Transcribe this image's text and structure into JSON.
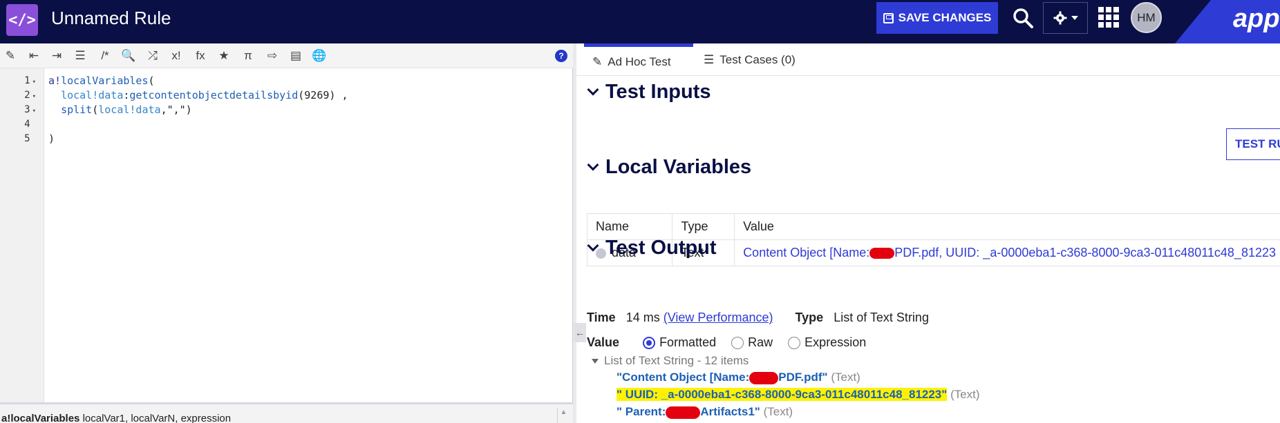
{
  "header": {
    "logo_glyph": "</>",
    "title": "Unnamed Rule",
    "save_label": "SAVE CHANGES",
    "avatar_initials": "HM",
    "brand": "appia",
    "icons": [
      "code-icon",
      "save-icon",
      "search-icon",
      "gear-icon",
      "chevron-down-icon",
      "app-grid-icon"
    ]
  },
  "editor": {
    "toolbar_icons": [
      "magic-wand-icon",
      "outdent-icon",
      "indent-icon",
      "list-icon",
      "comment-icon",
      "search-icon",
      "shuffle-icon",
      "factorial-icon",
      "function-icon",
      "star-icon",
      "pi-icon",
      "export-icon",
      "database-search-icon",
      "globe-icon"
    ],
    "toolbar_glyphs": [
      "✎",
      "⇤",
      "⇥",
      "☰",
      "/*",
      "🔍",
      "⤮",
      "x!",
      "fx",
      "★",
      "π",
      "⇨",
      "▤",
      "🌐"
    ],
    "help_glyph": "?",
    "line_numbers": [
      "1",
      "2",
      "3",
      "4",
      "5"
    ],
    "code_lines": [
      {
        "parts": [
          [
            "a!",
            "k-purple"
          ],
          [
            "localVariables",
            "k-blue"
          ],
          [
            "(",
            "k-dark"
          ]
        ]
      },
      {
        "parts": [
          [
            "  ",
            "k-dark"
          ],
          [
            "local!data",
            "k-lv"
          ],
          [
            ":",
            "k-dark"
          ],
          [
            "getcontentobjectdetailsbyid",
            "k-blue"
          ],
          [
            "(",
            "k-dark"
          ],
          [
            "9269",
            "k-num"
          ],
          [
            ") ,",
            "k-dark"
          ]
        ]
      },
      {
        "parts": [
          [
            "  ",
            "k-dark"
          ],
          [
            "split",
            "k-blue"
          ],
          [
            "(",
            "k-dark"
          ],
          [
            "local!data",
            "k-lv"
          ],
          [
            ",\",\")",
            "k-dark"
          ]
        ]
      },
      {
        "parts": []
      },
      {
        "parts": [
          [
            ")",
            "k-dark"
          ]
        ]
      }
    ],
    "hint": {
      "bold": "a!localVariables",
      "rest": " localVar1, localVarN, expression"
    }
  },
  "tabs": [
    {
      "label": "Ad Hoc Test",
      "icon": "edit-icon",
      "glyph": "✎",
      "active": true
    },
    {
      "label": "Test Cases (0)",
      "icon": "list-icon",
      "glyph": "☰",
      "active": false
    }
  ],
  "test_inputs": {
    "heading": "Test Inputs",
    "test_button": "TEST RULE"
  },
  "local_variables": {
    "heading": "Local Variables",
    "columns": [
      "Name",
      "Type",
      "Value"
    ],
    "rows": [
      {
        "name": "data",
        "type": "Text",
        "value_prefix": "Content Object [Name:",
        "value_suffix": "PDF.pdf, UUID: _a-0000eba1-c368-8000-9ca3-011c48011c48_81223"
      }
    ]
  },
  "test_output": {
    "heading": "Test Output",
    "time_label": "Time",
    "time_value": "14 ms",
    "perf_link": "(View Performance)",
    "type_label": "Type",
    "type_value": "List of Text String",
    "value_label": "Value",
    "radios": [
      {
        "label": "Formatted",
        "selected": true
      },
      {
        "label": "Raw",
        "selected": false
      },
      {
        "label": "Expression",
        "selected": false
      }
    ],
    "tree_header": "List of Text String - 12 items",
    "items": [
      {
        "pre": "\"Content Object [Name:",
        "post": "PDF.pdf\"",
        "type": "(Text)",
        "redacted": true,
        "highlight": false
      },
      {
        "pre": "\" UUID: _a-0000eba1-c368-8000-9ca3-011c48011c48_81223\"",
        "post": "",
        "type": "(Text)",
        "redacted": false,
        "highlight": true
      },
      {
        "pre": "\" Parent:",
        "post": "Artifacts1\"",
        "type": "(Text)",
        "redacted": true,
        "highlight": false
      }
    ]
  },
  "colors": {
    "header_bg": "#0a1045",
    "accent": "#2e3bd4",
    "logo_bg": "#8a4fd9",
    "highlight": "#fff200",
    "redaction": "#e3000f"
  }
}
